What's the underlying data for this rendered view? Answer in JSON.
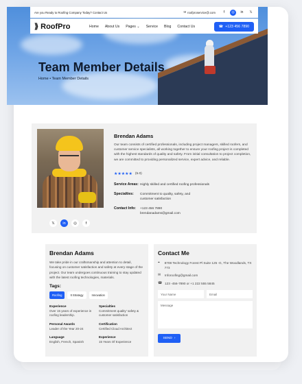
{
  "topbar": {
    "announcement": "Are you Ready to Roofing Company Today? Contact Us",
    "email": "roofproservice@.com",
    "socials": [
      "f",
      "◎",
      "in",
      "𝕏"
    ]
  },
  "nav": {
    "logo": "RoofPro",
    "items": [
      "Home",
      "About Us",
      "Pages",
      "Service",
      "Blog",
      "Contact Us"
    ],
    "cta": "+123 456 7890"
  },
  "hero": {
    "title": "Team Member Details",
    "breadcrumb": "Home • Team Member Details"
  },
  "profile": {
    "name": "Brendan Adams",
    "bio": "Our team consists of certified professionals, including project managers, skilled roofers, and customer service specialists, all working together to ensure your roofing project is completed with the highest standards of quality and safety. From initial consultation to project completion, we are committed to providing personalized service, expert advice, and reliable.",
    "stars": "★★★★★",
    "rating": "(5.0)",
    "service_label": "Service Areas:",
    "service_value": "Highly skilled and certified roofing professionals",
    "specialties_label": "Specialties:",
    "specialties_value": "Commitment to quality, safety, and customer satisfaction",
    "contact_label": "Contact Info:",
    "contact_phone": "+123 456 7890",
    "contact_email": "brendanadams@gmail.com",
    "socials": [
      "𝕏",
      "in",
      "◎",
      "f"
    ]
  },
  "about": {
    "title": "Brendan Adams",
    "text": "We take pride in our craftsmanship and attention to detail, focusing on customer satisfaction and safety at every stage of the project. Our team undergoes continuous training to stay updated with the latest roofing technologies, materials.",
    "tags_title": "Tags:",
    "tags": [
      "Roofing",
      "It Strategy",
      "Innovation"
    ],
    "facts": [
      {
        "title": "Experience",
        "value": "Over 15 years of experience in roofing leadership."
      },
      {
        "title": "Specialties",
        "value": "Commitment quality' safety & customer satisfaction"
      },
      {
        "title": "Personal Awards",
        "value": "Leader of the Year 20-24"
      },
      {
        "title": "Certification",
        "value": "Certified Cloud Architect"
      },
      {
        "title": "Language",
        "value": "English, French, Spanish"
      },
      {
        "title": "Experience",
        "value": "15 Years Of Experience"
      }
    ]
  },
  "contact": {
    "title": "Contact Me",
    "address": "8708 Technology Forest Pl Suite 125 -G, The Woodlands, TX 773",
    "email": "Inforoofing@gmail.com",
    "phone": "123 -456-7890 or +1 222 555 5845",
    "name_placeholder": "Your Name",
    "email_placeholder": "Email",
    "message_placeholder": "Message",
    "send": "SEND"
  }
}
